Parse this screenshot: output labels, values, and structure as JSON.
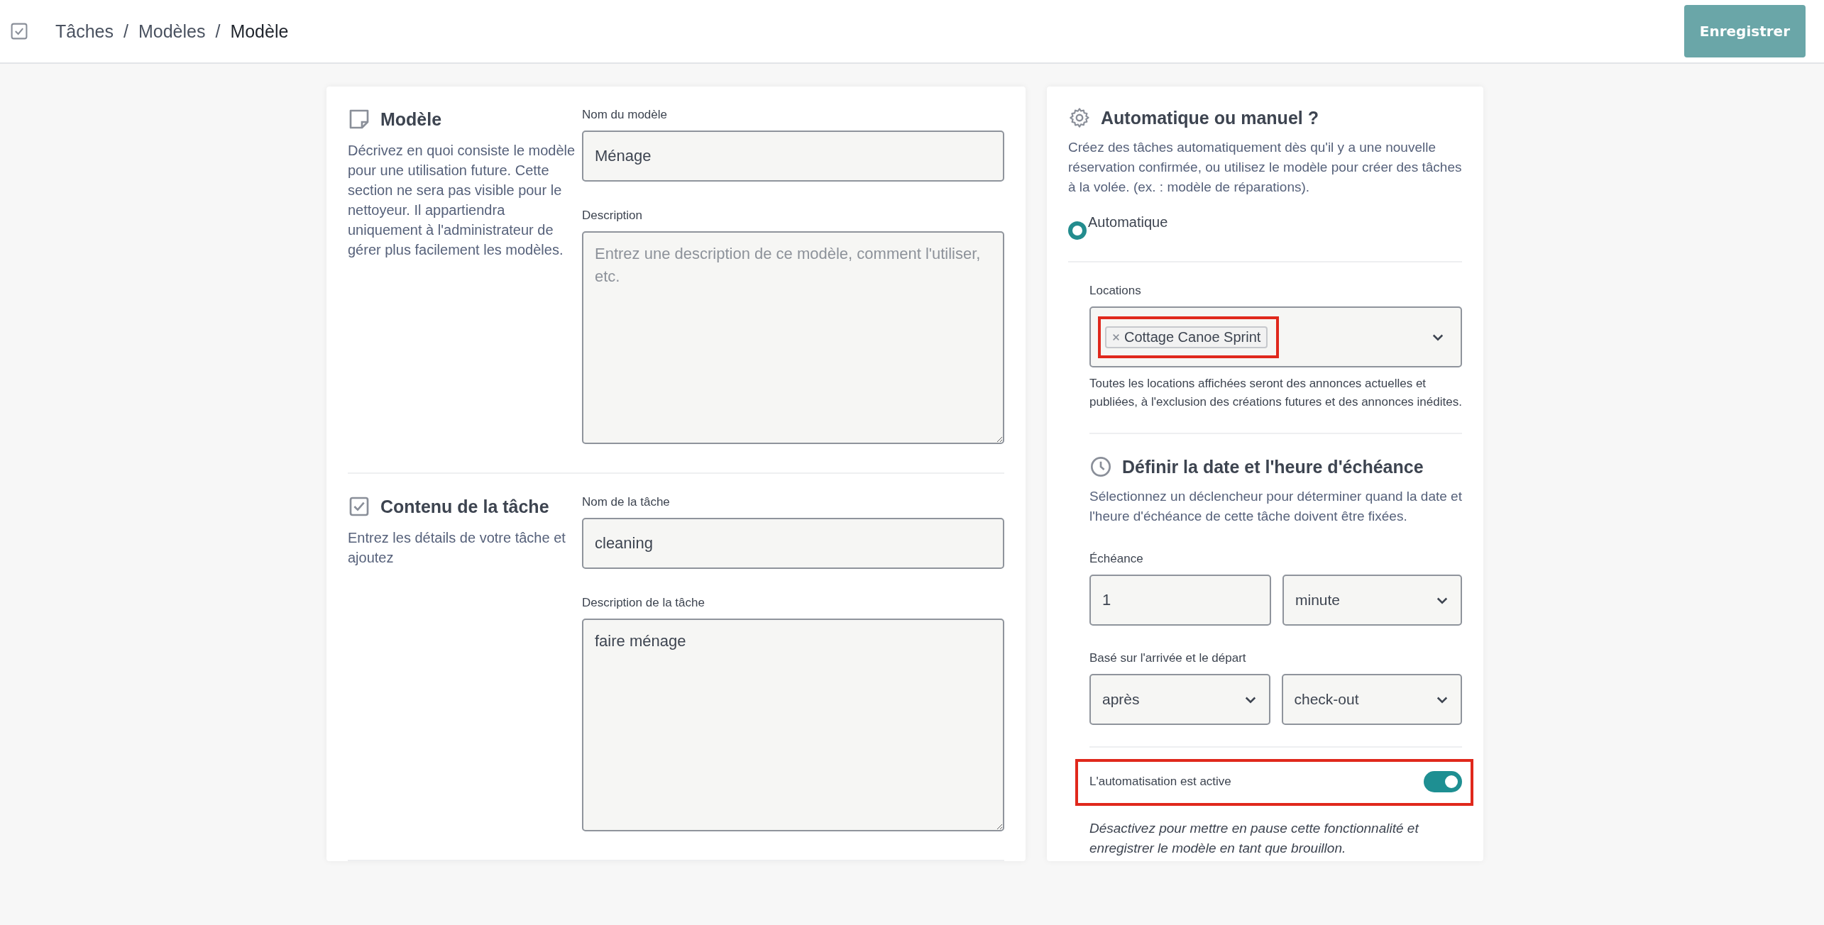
{
  "header": {
    "separator": "/",
    "breadcrumb": [
      {
        "label": "Tâches",
        "current": false
      },
      {
        "label": "Modèles",
        "current": false
      },
      {
        "label": "Modèle",
        "current": true
      }
    ],
    "save_button": "Enregistrer"
  },
  "left_card": {
    "sections": [
      {
        "kind": "note",
        "title": "Modèle",
        "description": "Décrivez en quoi consiste le modèle pour une utilisation future. Cette section ne sera pas visible pour le nettoyeur. Il appartiendra uniquement à l'administrateur de gérer plus facilement les modèles.",
        "fields": [
          {
            "kind": "input",
            "label": "Nom du modèle",
            "value": "Ménage"
          },
          {
            "kind": "textarea",
            "label": "Description",
            "placeholder": "Entrez une description de ce modèle, comment l'utiliser, etc."
          }
        ]
      },
      {
        "kind": "check",
        "title": "Contenu de la tâche",
        "description": "Entrez les détails de votre tâche et ajoutez",
        "fields": [
          {
            "kind": "input",
            "label": "Nom de la tâche",
            "value": "cleaning"
          },
          {
            "kind": "textarea",
            "label": "Description de la tâche",
            "value": "faire ménage"
          }
        ]
      }
    ]
  },
  "right_card": {
    "title": "Automatique ou manuel ?",
    "description": "Créez des tâches automatiquement dès qu'il y a une nouvelle réservation confirmée, ou utilisez le modèle pour créer des tâches à la volée. (ex. : modèle de réparations).",
    "mode_option": {
      "label": "Automatique",
      "selected": true
    },
    "locations": {
      "label": "Locations",
      "tags": [
        {
          "label": "Cottage Canoe Sprint",
          "highlighted": true
        }
      ],
      "help": "Toutes les locations affichées seront des annonces actuelles et publiées, à l'exclusion des créations futures et des annonces inédites."
    },
    "due": {
      "title": "Définir la date et l'heure d'échéance",
      "description": "Sélectionnez un déclencheur pour déterminer quand la date et l'heure d'échéance de cette tâche doivent être fixées.",
      "rows": [
        {
          "label": "Échéance",
          "controls": [
            {
              "kind": "input",
              "value": "1"
            },
            {
              "kind": "select",
              "value": "minute"
            }
          ]
        },
        {
          "label": "Basé sur l'arrivée et le départ",
          "controls": [
            {
              "kind": "select",
              "value": "après"
            },
            {
              "kind": "select",
              "value": "check-out"
            }
          ]
        }
      ]
    },
    "automation": {
      "label": "L'automatisation est active",
      "on": true,
      "highlighted": true,
      "note": "Désactivez pour mettre en pause cette fonctionnalité et enregistrer le modèle en tant que brouillon."
    }
  }
}
